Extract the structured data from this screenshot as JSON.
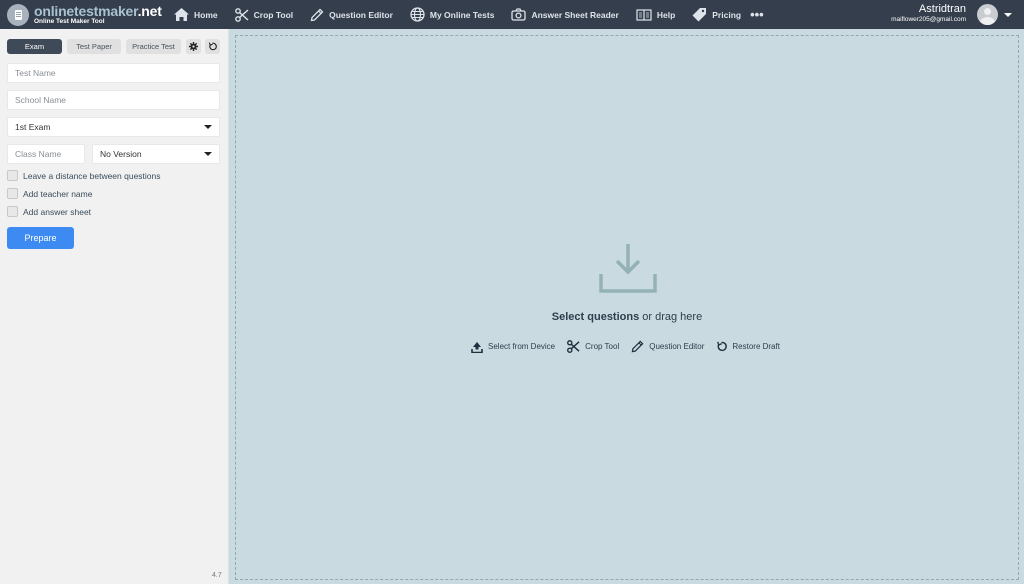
{
  "brand": {
    "title_main": "onlinetestmaker",
    "title_tld": ".net",
    "subtitle": "Online Test Maker Tool"
  },
  "nav": {
    "items": [
      {
        "label": "Home",
        "icon": "home-icon"
      },
      {
        "label": "Crop Tool",
        "icon": "scissors-icon"
      },
      {
        "label": "Question Editor",
        "icon": "pencil-icon"
      },
      {
        "label": "My Online Tests",
        "icon": "globe-icon"
      },
      {
        "label": "Answer Sheet Reader",
        "icon": "camera-icon"
      },
      {
        "label": "Help",
        "icon": "book-icon"
      },
      {
        "label": "Pricing",
        "icon": "tag-icon"
      }
    ],
    "more_label": "•••"
  },
  "user": {
    "name": "Astridtran",
    "email": "maiflower205@gmail.com"
  },
  "sidebar": {
    "tabs": [
      {
        "label": "Exam",
        "active": true
      },
      {
        "label": "Test Paper",
        "active": false
      },
      {
        "label": "Practice Test",
        "active": false
      }
    ],
    "test_name_placeholder": "Test Name",
    "school_name_placeholder": "School Name",
    "exam_select_value": "1st Exam",
    "class_name_placeholder": "Class Name",
    "version_select_value": "No Version",
    "checkboxes": [
      {
        "label": "Leave a distance between questions",
        "checked": false
      },
      {
        "label": "Add teacher name",
        "checked": false
      },
      {
        "label": "Add answer sheet",
        "checked": false
      }
    ],
    "prepare_label": "Prepare",
    "version": "4.7"
  },
  "dropzone": {
    "title_bold": "Select questions",
    "title_rest": " or drag here",
    "actions": [
      {
        "label": "Select from Device",
        "icon": "upload-icon"
      },
      {
        "label": "Crop Tool",
        "icon": "scissors-icon"
      },
      {
        "label": "Question Editor",
        "icon": "pencil-icon"
      },
      {
        "label": "Restore Draft",
        "icon": "restore-icon"
      }
    ]
  },
  "colors": {
    "topbar": "#343e4d",
    "accent": "#3d8bf2",
    "dropzone_bg": "#c9dae0",
    "active_tab": "#3f4a58"
  }
}
